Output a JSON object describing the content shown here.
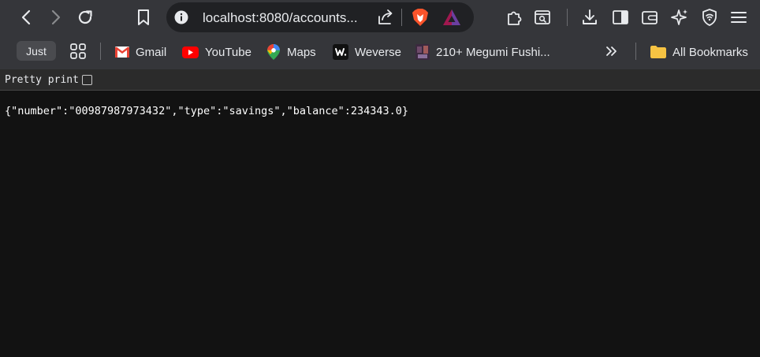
{
  "browser": {
    "url": "localhost:8080/accounts...",
    "tab_group_label": "Just"
  },
  "bookmarks": [
    {
      "label": "Gmail",
      "icon": "gmail-icon"
    },
    {
      "label": "YouTube",
      "icon": "youtube-icon"
    },
    {
      "label": "Maps",
      "icon": "maps-icon"
    },
    {
      "label": "Weverse",
      "icon": "weverse-icon"
    },
    {
      "label": "210+ Megumi Fushi...",
      "icon": "megumi-thumbnail-icon"
    }
  ],
  "all_bookmarks_label": "All Bookmarks",
  "page": {
    "pretty_print_label": "Pretty print",
    "json_text": "{\"number\":\"00987987973432\",\"type\":\"savings\",\"balance\":234343.0}"
  },
  "colors": {
    "toolbar_bg": "#35363a",
    "page_bg": "#121212",
    "gmail_red": "#ea4335",
    "youtube_red": "#ff0000",
    "brave_orange": "#fb542b"
  }
}
